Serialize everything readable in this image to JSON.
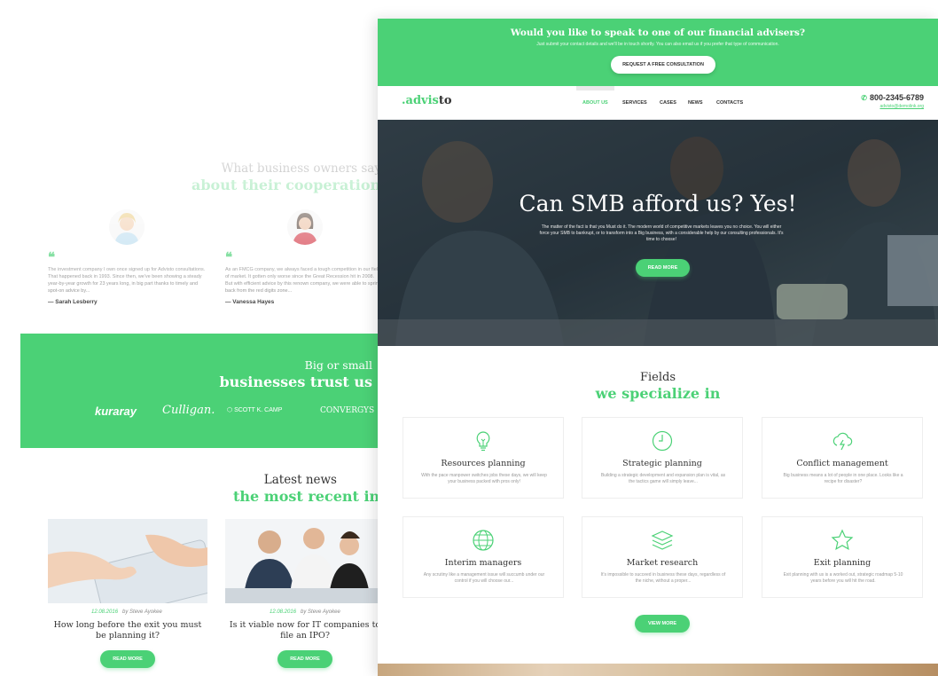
{
  "back": {
    "testimonials": {
      "title_dark": "What business owners say",
      "title_green": "about their cooperation wi",
      "items": [
        {
          "text": "The investment company I own once signed up for Advisto consultations. That happened back in 1993. Since then, we've been showing a steady year-by-year growth for 23 years long, in big part thanks to timely and spot-on advice by...",
          "name": "— Sarah Lesberry"
        },
        {
          "text": "As an FMCG company, we always faced a tough competition in our field of market. It gotten only worse since the Great Recession hit in 2008. But with efficient advice by this renown company, we were able to spring back from the red digits zone...",
          "name": "— Vanessa Hayes"
        }
      ]
    },
    "trust": {
      "title_light": "Big or small",
      "title_bold": "businesses trust us",
      "logos": [
        "kuraray",
        "Culligan.",
        "SCOTT K. CAMP",
        "CONVERGYS"
      ]
    },
    "news": {
      "title_dark": "Latest news",
      "title_green": "the most recent info",
      "items": [
        {
          "date": "12.08.2016",
          "author": "by Steve Ayokee",
          "title": "How long before the exit you must be planning it?",
          "button": "READ MORE"
        },
        {
          "date": "12.08.2016",
          "author": "by Steve Ayokee",
          "title": "Is it viable now for IT companies to file an IPO?",
          "button": "READ MORE"
        }
      ]
    }
  },
  "front": {
    "cta": {
      "question": "Would you like to speak to one of our financial advisers?",
      "subtext": "Just submit your contact details and we'll be in touch shortly. You can also email us if you prefer that type of communication.",
      "button": "REQUEST A FREE CONSULTATION"
    },
    "nav": {
      "logo_dot": ".",
      "logo_a": "advis",
      "logo_b": "to",
      "items": [
        "ABOUT US",
        "SERVICES",
        "CASES",
        "NEWS",
        "CONTACTS"
      ],
      "active": "ABOUT US",
      "phone": "800-2345-6789",
      "email": "advisto@demolink.org"
    },
    "hero": {
      "title": "Can SMB afford us? Yes!",
      "text": "The matter of the fact is that you Must do it. The modern world of competitive markets leaves you no choice. You will either force your SMB to bankrupt, or to transform into a Big business, with a considerable help by our consulting professionals. It's time to choose!",
      "button": "READ MORE"
    },
    "fields": {
      "title_dark": "Fields",
      "title_green": "we specialize in",
      "cards": [
        {
          "icon": "lightbulb-icon",
          "title": "Resources planning",
          "desc": "With the pace manpower switches jobs these days, we will keep your business packed with pros only!"
        },
        {
          "icon": "clock-icon",
          "title": "Strategic planning",
          "desc": "Building a strategic development and expansion plan is vital, as the tactics game will simply leave..."
        },
        {
          "icon": "cloud-lightning-icon",
          "title": "Conflict management",
          "desc": "Big business means a lot of people in one place. Looks like a recipe for disaster?"
        },
        {
          "icon": "globe-icon",
          "title": "Interim managers",
          "desc": "Any scrutiny like a management issue will succumb under our control if you will choose our..."
        },
        {
          "icon": "layers-icon",
          "title": "Market research",
          "desc": "It's impossible to succeed in business these days, regardless of the niche, without a proper..."
        },
        {
          "icon": "star-icon",
          "title": "Exit planning",
          "desc": "Exit planning with us is a worked out, strategic roadmap 5-10 years before you will hit the road."
        }
      ],
      "button": "VIEW MORE"
    }
  },
  "colors": {
    "accent": "#4bd176",
    "text": "#333333"
  }
}
